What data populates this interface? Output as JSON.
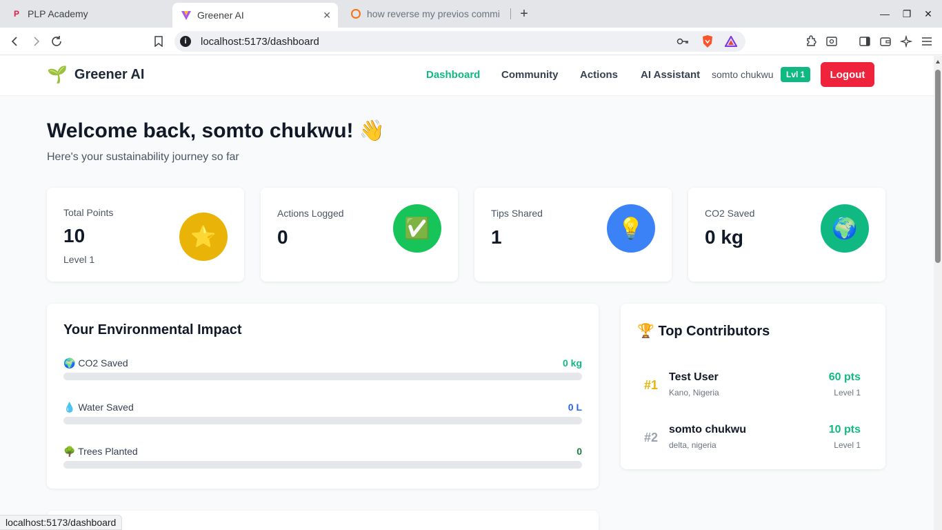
{
  "browser": {
    "tabs": [
      {
        "title": "PLP Academy",
        "active": false
      },
      {
        "title": "Greener AI",
        "active": true
      },
      {
        "title": "how reverse my previos commi",
        "active": false
      }
    ],
    "url": "localhost:5173/dashboard",
    "status_url": "localhost:5173/dashboard"
  },
  "header": {
    "brand": "Greener AI",
    "nav": [
      {
        "label": "Dashboard",
        "active": true
      },
      {
        "label": "Community",
        "active": false
      },
      {
        "label": "Actions",
        "active": false
      },
      {
        "label": "AI Assistant",
        "active": false
      }
    ],
    "user_name": "somto chukwu",
    "level_badge": "Lvl 1",
    "logout_label": "Logout"
  },
  "welcome": {
    "title": "Welcome back, somto chukwu! 👋",
    "subtitle": "Here's your sustainability journey so far"
  },
  "stats": [
    {
      "label": "Total Points",
      "value": "10",
      "sub": "Level 1",
      "icon": "⭐",
      "icon_name": "star-icon",
      "color": "#eab308"
    },
    {
      "label": "Actions Logged",
      "value": "0",
      "sub": "",
      "icon": "✅",
      "icon_name": "check-icon",
      "color": "#16c45a"
    },
    {
      "label": "Tips Shared",
      "value": "1",
      "sub": "",
      "icon": "💡",
      "icon_name": "lightbulb-icon",
      "color": "#3b82f6"
    },
    {
      "label": "CO2 Saved",
      "value": "0 kg",
      "sub": "",
      "icon": "🌍",
      "icon_name": "globe-icon",
      "color": "#10b981"
    }
  ],
  "impact": {
    "title": "Your Environmental Impact",
    "rows": [
      {
        "icon": "🌍",
        "label": "CO2 Saved",
        "value": "0 kg",
        "color": "#10b981",
        "progress": 0
      },
      {
        "icon": "💧",
        "label": "Water Saved",
        "value": "0 L",
        "color": "#2563eb",
        "progress": 0
      },
      {
        "icon": "🌳",
        "label": "Trees Planted",
        "value": "0",
        "color": "#15803d",
        "progress": 0
      }
    ]
  },
  "contributors": {
    "title": "🏆 Top Contributors",
    "list": [
      {
        "rank": "#1",
        "name": "Test User",
        "location": "Kano, Nigeria",
        "points": "60 pts",
        "level": "Level 1",
        "rank_color": "#eab308"
      },
      {
        "rank": "#2",
        "name": "somto chukwu",
        "location": "delta, nigeria",
        "points": "10 pts",
        "level": "Level 1",
        "rank_color": "#9ca3af"
      }
    ]
  }
}
